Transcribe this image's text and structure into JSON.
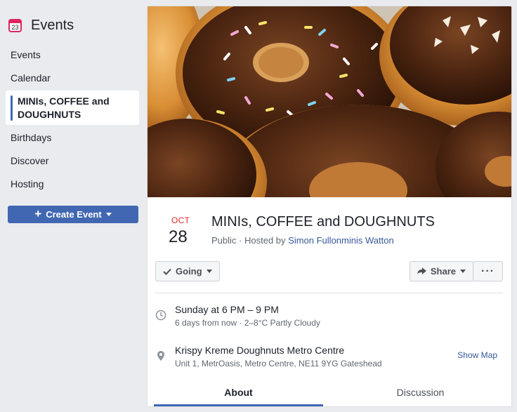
{
  "sidebar": {
    "title": "Events",
    "calendar_day": "23",
    "items": [
      {
        "label": "Events"
      },
      {
        "label": "Calendar"
      },
      {
        "label": "MINIs, COFFEE and DOUGHNUTS",
        "active": true
      },
      {
        "label": "Birthdays"
      },
      {
        "label": "Discover"
      },
      {
        "label": "Hosting"
      }
    ],
    "create_button": "Create Event"
  },
  "event": {
    "month": "OCT",
    "day": "28",
    "title": "MINIs, COFFEE and DOUGHNUTS",
    "privacy": "Public",
    "hosted_by_prefix": "Hosted by",
    "host": "Simon Fullonminis Watton",
    "cover_icon": "doughnuts-photo"
  },
  "actions": {
    "going": "Going",
    "share": "Share",
    "more": "···"
  },
  "details": {
    "time_main": "Sunday at 6 PM – 9 PM",
    "time_sub": "6 days from now · 2–8°C Partly Cloudy",
    "place_main": "Krispy Kreme Doughnuts Metro Centre",
    "place_sub": "Unit 1, MetrOasis, Metro Centre, NE11 9YG Gateshead",
    "show_map": "Show Map"
  },
  "tabs": [
    {
      "label": "About",
      "active": true
    },
    {
      "label": "Discussion",
      "active": false
    }
  ],
  "colors": {
    "accent": "#4267b2",
    "link": "#385898",
    "date_red": "#e02828",
    "page_bg": "#e9ebee"
  }
}
